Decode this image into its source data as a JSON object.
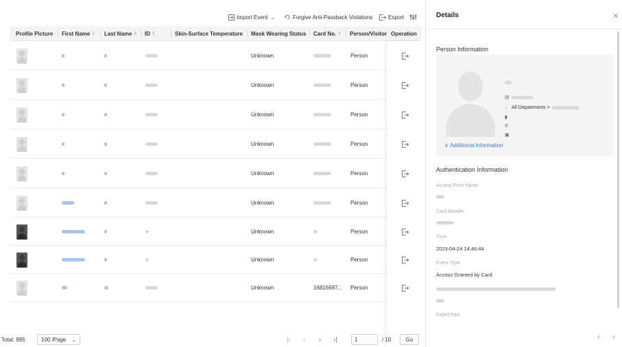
{
  "toolbar": {
    "import_event": "Import Event",
    "forgive": "Forgive Anti-Passback Violations",
    "export": "Export"
  },
  "table": {
    "columns": [
      "Profile Picture",
      "First Name",
      "Last Name",
      "ID",
      "Skin-Surface Temperature",
      "Mask Wearing Status",
      "Card No.",
      "Person/Visitor",
      "Operation"
    ],
    "rows": [
      {
        "mask": "Unknown",
        "type": "Person",
        "card": ""
      },
      {
        "mask": "Unknown",
        "type": "Person",
        "card": ""
      },
      {
        "mask": "Unknown",
        "type": "Person",
        "card": ""
      },
      {
        "mask": "Unknown",
        "type": "Person",
        "card": ""
      },
      {
        "mask": "Unknown",
        "type": "Person",
        "card": ""
      },
      {
        "mask": "Unknown",
        "type": "Person",
        "card": ""
      },
      {
        "mask": "Unknown",
        "type": "Person",
        "card": ""
      },
      {
        "mask": "Unknown",
        "type": "Person",
        "card": ""
      },
      {
        "mask": "Unknown",
        "type": "Person",
        "card": "16816687..."
      }
    ]
  },
  "footer": {
    "total": "Total: 995",
    "page_size": "100 /Page",
    "page": "1",
    "page_total": "/ 10",
    "go": "Go"
  },
  "details": {
    "title": "Details",
    "person_info_title": "Person Information",
    "department": "All Departments >",
    "additional": "Additional Information",
    "auth_title": "Authentication Information",
    "access_point_label": "Access Point Name",
    "card_reader_label": "Card Reader",
    "time_label": "Time",
    "time_value": "2023-04-24 14:46:44",
    "event_type_label": "Event Type",
    "event_type_value": "Access Granted by Card",
    "failed_part_label": "Failed Part"
  }
}
